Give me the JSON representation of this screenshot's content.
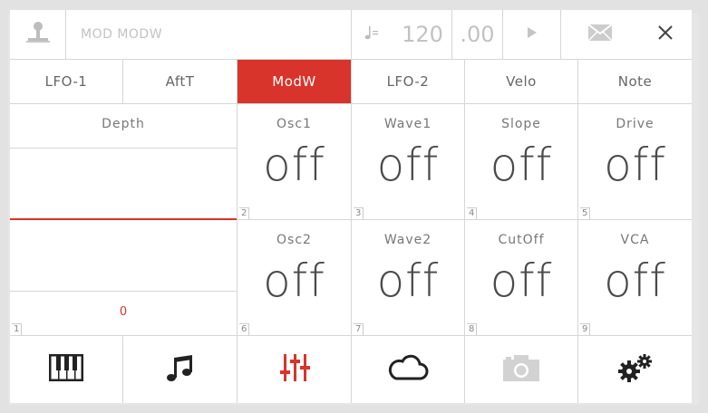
{
  "topbar": {
    "title": "MOD MODW",
    "tempo": "120",
    "fraction": ".00"
  },
  "tabs": [
    {
      "label": "LFO-1"
    },
    {
      "label": "AftT"
    },
    {
      "label": "ModW",
      "active": true
    },
    {
      "label": "LFO-2"
    },
    {
      "label": "Velo"
    },
    {
      "label": "Note"
    }
  ],
  "depth": {
    "label": "Depth",
    "value": "0",
    "slot": "1",
    "accent": "#d8342b"
  },
  "params": [
    {
      "label": "Osc1",
      "value": "off",
      "slot": "2"
    },
    {
      "label": "Wave1",
      "value": "off",
      "slot": "3"
    },
    {
      "label": "Slope",
      "value": "off",
      "slot": "4"
    },
    {
      "label": "Drive",
      "value": "off",
      "slot": "5"
    },
    {
      "label": "Osc2",
      "value": "off",
      "slot": "6"
    },
    {
      "label": "Wave2",
      "value": "off",
      "slot": "7"
    },
    {
      "label": "CutOff",
      "value": "off",
      "slot": "8"
    },
    {
      "label": "VCA",
      "value": "off",
      "slot": "9"
    }
  ],
  "nav": [
    {
      "icon": "piano-keys-icon"
    },
    {
      "icon": "music-note-icon"
    },
    {
      "icon": "mixer-sliders-icon",
      "active": true
    },
    {
      "icon": "cloud-icon"
    },
    {
      "icon": "camera-icon"
    },
    {
      "icon": "gears-icon"
    }
  ]
}
